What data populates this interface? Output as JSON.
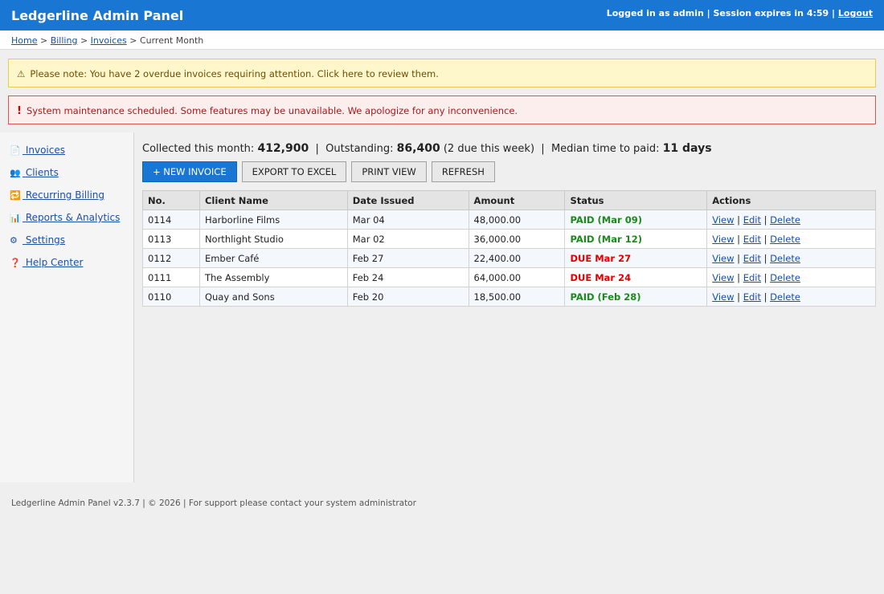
{
  "header": {
    "title": "Ledgerline Admin Panel",
    "session_text": "Logged in as admin | Session expires in 4:59 |",
    "logout_label": "Logout"
  },
  "breadcrumb": {
    "home": "Home",
    "billing": "Billing",
    "invoices": "Invoices",
    "current": "Current Month",
    "separator": ">"
  },
  "alerts": {
    "warning": {
      "icon": "⚠",
      "text": "Please note: You have 2 overdue invoices requiring attention. Click here to review them."
    },
    "error": {
      "icon": "!",
      "text": "System maintenance scheduled. Some features may be unavailable. We apologize for any inconvenience."
    }
  },
  "sidebar": {
    "items": [
      {
        "icon": "📄",
        "label": "Invoices"
      },
      {
        "icon": "👥",
        "label": "Clients"
      },
      {
        "icon": "🔁",
        "label": "Recurring Billing"
      },
      {
        "icon": "📊",
        "label": "Reports & Analytics"
      },
      {
        "icon": "⚙",
        "label": "Settings"
      },
      {
        "icon": "❓",
        "label": "Help Center"
      }
    ]
  },
  "stats": {
    "collected_label": "Collected this month:",
    "collected_value": "412,900",
    "outstanding_label": "Outstanding:",
    "outstanding_value": "86,400",
    "outstanding_note": "(2 due this week)",
    "median_label": "Median time to paid:",
    "median_value": "11 days",
    "separator": "|"
  },
  "toolbar": {
    "new_invoice": "+ NEW INVOICE",
    "export": "EXPORT TO EXCEL",
    "print": "PRINT VIEW",
    "refresh": "REFRESH"
  },
  "table": {
    "headers": [
      "No.",
      "Client Name",
      "Date Issued",
      "Amount",
      "Status",
      "Actions"
    ],
    "rows": [
      {
        "no": "0114",
        "client": "Harborline Films",
        "date": "Mar 04",
        "amount": "48,000.00",
        "status": "PAID (Mar 09)",
        "status_type": "paid"
      },
      {
        "no": "0113",
        "client": "Northlight Studio",
        "date": "Mar 02",
        "amount": "36,000.00",
        "status": "PAID (Mar 12)",
        "status_type": "paid"
      },
      {
        "no": "0112",
        "client": "Ember Café",
        "date": "Feb 27",
        "amount": "22,400.00",
        "status": "DUE Mar 27",
        "status_type": "due"
      },
      {
        "no": "0111",
        "client": "The Assembly",
        "date": "Feb 24",
        "amount": "64,000.00",
        "status": "DUE Mar 24",
        "status_type": "due"
      },
      {
        "no": "0110",
        "client": "Quay and Sons",
        "date": "Feb 20",
        "amount": "18,500.00",
        "status": "PAID (Feb 28)",
        "status_type": "paid"
      }
    ],
    "actions": {
      "view": "View",
      "edit": "Edit",
      "delete": "Delete",
      "separator": "|"
    }
  },
  "footer": {
    "text": "Ledgerline Admin Panel v2.3.7 | © 2026 | For support please contact your system administrator"
  },
  "colors": {
    "header_bg": "#1976d2",
    "paid": "#1a8a1a",
    "due": "#e00000",
    "link": "#1a4fa8"
  }
}
